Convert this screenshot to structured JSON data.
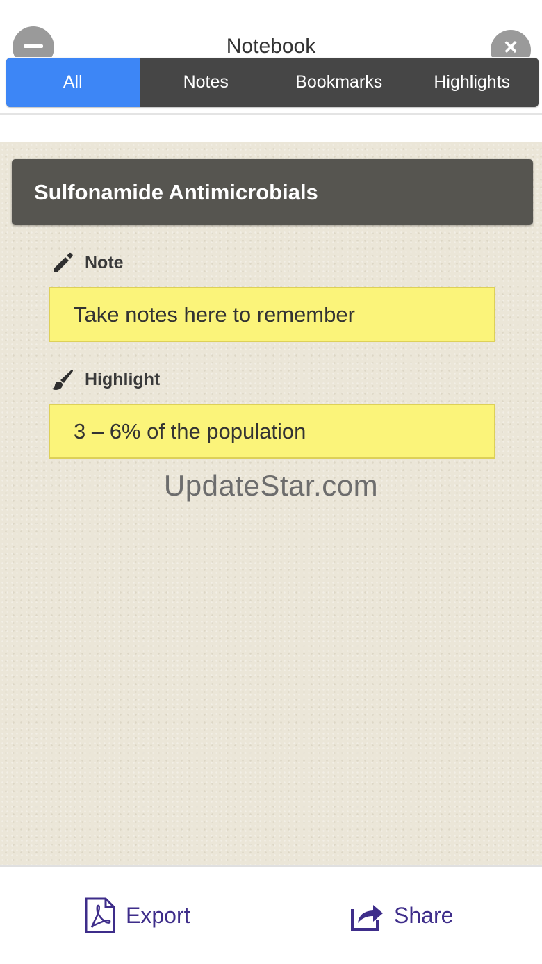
{
  "header": {
    "title": "Notebook"
  },
  "tabs": [
    {
      "label": "All",
      "active": true
    },
    {
      "label": "Notes",
      "active": false
    },
    {
      "label": "Bookmarks",
      "active": false
    },
    {
      "label": "Highlights",
      "active": false
    }
  ],
  "section": {
    "title": "Sulfonamide Antimicrobials"
  },
  "note": {
    "label": "Note",
    "icon": "pencil-icon",
    "text": "Take notes here to remember"
  },
  "highlight": {
    "label": "Highlight",
    "icon": "brush-icon",
    "text": "3 – 6% of the population"
  },
  "watermark": "UpdateStar.com",
  "footer": {
    "export_label": "Export",
    "share_label": "Share"
  },
  "colors": {
    "tab_active": "#3d86f6",
    "tab_bar": "#464646",
    "section_header": "#565550",
    "highlight_fill": "#fbf47a",
    "footer_accent": "#3e2d8a",
    "paper": "#ebe6d8"
  }
}
